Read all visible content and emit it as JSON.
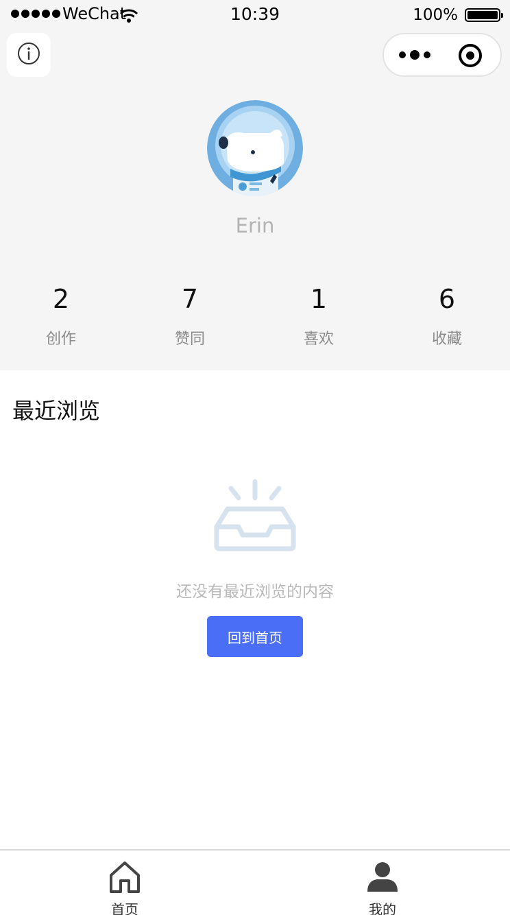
{
  "status_bar": {
    "carrier": "WeChat",
    "time": "10:39",
    "battery": "100%"
  },
  "header": {
    "info_icon": "info-icon",
    "more_icon": "more-dots-icon",
    "target_icon": "record-target-icon"
  },
  "profile": {
    "avatar": "avatar-dog-astronaut",
    "name": "Erin"
  },
  "stats": [
    {
      "value": "2",
      "label": "创作"
    },
    {
      "value": "7",
      "label": "赞同"
    },
    {
      "value": "1",
      "label": "喜欢"
    },
    {
      "value": "6",
      "label": "收藏"
    }
  ],
  "recent": {
    "title": "最近浏览",
    "empty_text": "还没有最近浏览的内容",
    "button_label": "回到首页",
    "empty_icon": "empty-inbox-icon"
  },
  "tabs": [
    {
      "label": "首页",
      "icon": "home-icon"
    },
    {
      "label": "我的",
      "icon": "user-icon"
    }
  ],
  "colors": {
    "accent": "#4a6ef5",
    "header_bg": "#f5f5f5",
    "muted_text": "#b3b3b3"
  }
}
